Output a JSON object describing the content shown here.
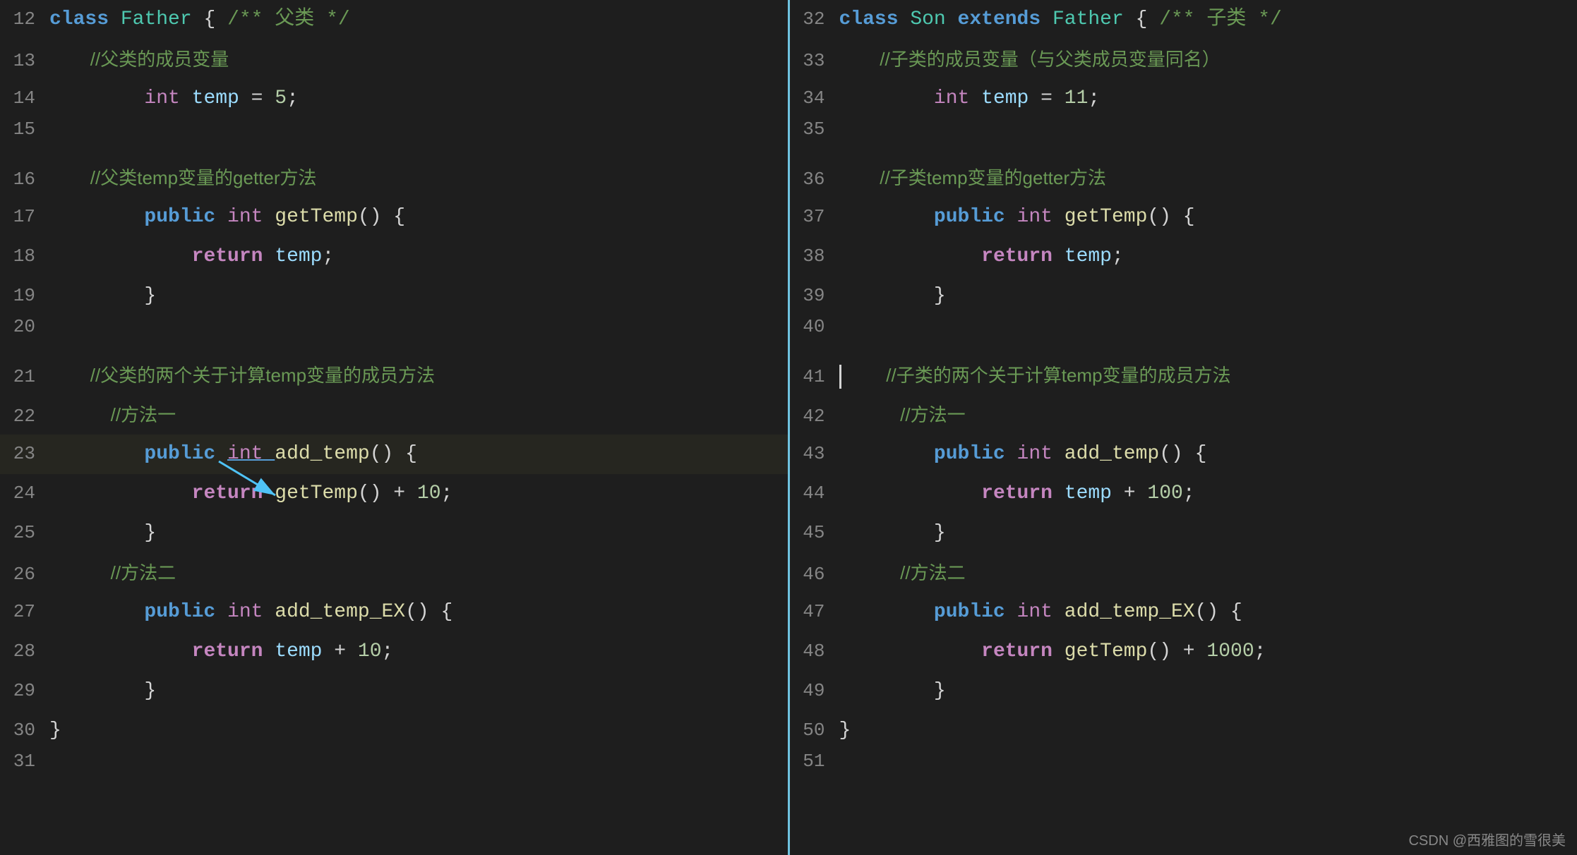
{
  "left": {
    "title": "Father",
    "lines": [
      {
        "num": 12,
        "tokens": [
          {
            "t": "kw-blue",
            "v": "class "
          },
          {
            "t": "classname",
            "v": "Father "
          },
          {
            "t": "plain",
            "v": "{ "
          },
          {
            "t": "comment",
            "v": "/** 父类 */"
          }
        ]
      },
      {
        "num": 13,
        "tokens": [
          {
            "t": "comment-cn",
            "v": "        //父类的成员变量"
          }
        ]
      },
      {
        "num": 14,
        "tokens": [
          {
            "t": "plain",
            "v": "        "
          },
          {
            "t": "type-int",
            "v": "int "
          },
          {
            "t": "var",
            "v": "temp "
          },
          {
            "t": "plain",
            "v": "= "
          },
          {
            "t": "num",
            "v": "5"
          },
          {
            "t": "plain",
            "v": ";"
          }
        ]
      },
      {
        "num": 15,
        "tokens": []
      },
      {
        "num": 16,
        "tokens": [
          {
            "t": "comment-cn",
            "v": "        //父类temp变量的getter方法"
          }
        ]
      },
      {
        "num": 17,
        "tokens": [
          {
            "t": "plain",
            "v": "        "
          },
          {
            "t": "kw-blue",
            "v": "public "
          },
          {
            "t": "type-int",
            "v": "int "
          },
          {
            "t": "fn",
            "v": "getTemp"
          },
          {
            "t": "plain",
            "v": "() {"
          }
        ]
      },
      {
        "num": 18,
        "tokens": [
          {
            "t": "plain",
            "v": "            "
          },
          {
            "t": "kw",
            "v": "return "
          },
          {
            "t": "var",
            "v": "temp"
          },
          {
            "t": "plain",
            "v": ";"
          }
        ]
      },
      {
        "num": 19,
        "tokens": [
          {
            "t": "plain",
            "v": "        }"
          }
        ]
      },
      {
        "num": 20,
        "tokens": []
      },
      {
        "num": 21,
        "tokens": [
          {
            "t": "comment-cn",
            "v": "        //父类的两个关于计算temp变量的成员方法"
          }
        ]
      },
      {
        "num": 22,
        "tokens": [
          {
            "t": "comment-cn",
            "v": "            //方法一"
          }
        ]
      },
      {
        "num": 23,
        "tokens": [
          {
            "t": "plain",
            "v": "        "
          },
          {
            "t": "kw-blue",
            "v": "public "
          },
          {
            "t": "type-int",
            "v": "int "
          },
          {
            "t": "fn",
            "v": "add_temp"
          },
          {
            "t": "plain",
            "v": "() {"
          }
        ],
        "highlight": true,
        "underline_int": true
      },
      {
        "num": 24,
        "tokens": [
          {
            "t": "plain",
            "v": "            "
          },
          {
            "t": "kw",
            "v": "return "
          },
          {
            "t": "fn",
            "v": "getTemp"
          },
          {
            "t": "plain",
            "v": "() + "
          },
          {
            "t": "num",
            "v": "10"
          },
          {
            "t": "plain",
            "v": ";"
          }
        ],
        "arrow": true
      },
      {
        "num": 25,
        "tokens": [
          {
            "t": "plain",
            "v": "        }"
          }
        ]
      },
      {
        "num": 26,
        "tokens": [
          {
            "t": "comment-cn",
            "v": "            //方法二"
          }
        ]
      },
      {
        "num": 27,
        "tokens": [
          {
            "t": "plain",
            "v": "        "
          },
          {
            "t": "kw-blue",
            "v": "public "
          },
          {
            "t": "type-int",
            "v": "int "
          },
          {
            "t": "fn",
            "v": "add_temp_EX"
          },
          {
            "t": "plain",
            "v": "() {"
          }
        ]
      },
      {
        "num": 28,
        "tokens": [
          {
            "t": "plain",
            "v": "            "
          },
          {
            "t": "kw",
            "v": "return "
          },
          {
            "t": "var",
            "v": "temp"
          },
          {
            "t": "plain",
            "v": " + "
          },
          {
            "t": "num",
            "v": "10"
          },
          {
            "t": "plain",
            "v": ";"
          }
        ]
      },
      {
        "num": 29,
        "tokens": [
          {
            "t": "plain",
            "v": "        }"
          }
        ]
      },
      {
        "num": 30,
        "tokens": [
          {
            "t": "plain",
            "v": "}"
          }
        ]
      },
      {
        "num": 31,
        "tokens": []
      }
    ]
  },
  "right": {
    "title": "Son extends Father",
    "lines": [
      {
        "num": 32,
        "tokens": [
          {
            "t": "kw-blue",
            "v": "class "
          },
          {
            "t": "classname",
            "v": "Son "
          },
          {
            "t": "kw-blue",
            "v": "extends "
          },
          {
            "t": "classname",
            "v": "Father "
          },
          {
            "t": "plain",
            "v": "{ "
          },
          {
            "t": "comment",
            "v": "/** 子类 */"
          }
        ]
      },
      {
        "num": 33,
        "tokens": [
          {
            "t": "comment-cn",
            "v": "        //子类的成员变量（与父类成员变量同名）"
          }
        ]
      },
      {
        "num": 34,
        "tokens": [
          {
            "t": "plain",
            "v": "        "
          },
          {
            "t": "type-int",
            "v": "int "
          },
          {
            "t": "var",
            "v": "temp "
          },
          {
            "t": "plain",
            "v": "= "
          },
          {
            "t": "num",
            "v": "11"
          },
          {
            "t": "plain",
            "v": ";"
          }
        ]
      },
      {
        "num": 35,
        "tokens": []
      },
      {
        "num": 36,
        "tokens": [
          {
            "t": "comment-cn",
            "v": "        //子类temp变量的getter方法"
          }
        ]
      },
      {
        "num": 37,
        "tokens": [
          {
            "t": "plain",
            "v": "        "
          },
          {
            "t": "kw-blue",
            "v": "public "
          },
          {
            "t": "type-int",
            "v": "int "
          },
          {
            "t": "fn",
            "v": "getTemp"
          },
          {
            "t": "plain",
            "v": "() {"
          }
        ]
      },
      {
        "num": 38,
        "tokens": [
          {
            "t": "plain",
            "v": "            "
          },
          {
            "t": "kw",
            "v": "return "
          },
          {
            "t": "var",
            "v": "temp"
          },
          {
            "t": "plain",
            "v": ";"
          }
        ]
      },
      {
        "num": 39,
        "tokens": [
          {
            "t": "plain",
            "v": "        }"
          }
        ]
      },
      {
        "num": 40,
        "tokens": []
      },
      {
        "num": 41,
        "tokens": [
          {
            "t": "comment-cn",
            "v": "        //子类的两个关于计算temp变量的成员方法"
          }
        ],
        "cursor": true
      },
      {
        "num": 42,
        "tokens": [
          {
            "t": "comment-cn",
            "v": "            //方法一"
          }
        ]
      },
      {
        "num": 43,
        "tokens": [
          {
            "t": "plain",
            "v": "        "
          },
          {
            "t": "kw-blue",
            "v": "public "
          },
          {
            "t": "type-int",
            "v": "int "
          },
          {
            "t": "fn",
            "v": "add_temp"
          },
          {
            "t": "plain",
            "v": "() {"
          }
        ]
      },
      {
        "num": 44,
        "tokens": [
          {
            "t": "plain",
            "v": "            "
          },
          {
            "t": "kw",
            "v": "return "
          },
          {
            "t": "var",
            "v": "temp"
          },
          {
            "t": "plain",
            "v": " + "
          },
          {
            "t": "num",
            "v": "100"
          },
          {
            "t": "plain",
            "v": ";"
          }
        ]
      },
      {
        "num": 45,
        "tokens": [
          {
            "t": "plain",
            "v": "        }"
          }
        ]
      },
      {
        "num": 46,
        "tokens": [
          {
            "t": "comment-cn",
            "v": "            //方法二"
          }
        ]
      },
      {
        "num": 47,
        "tokens": [
          {
            "t": "plain",
            "v": "        "
          },
          {
            "t": "kw-blue",
            "v": "public "
          },
          {
            "t": "type-int",
            "v": "int "
          },
          {
            "t": "fn",
            "v": "add_temp_EX"
          },
          {
            "t": "plain",
            "v": "() {"
          }
        ]
      },
      {
        "num": 48,
        "tokens": [
          {
            "t": "plain",
            "v": "            "
          },
          {
            "t": "kw",
            "v": "return "
          },
          {
            "t": "fn",
            "v": "getTemp"
          },
          {
            "t": "plain",
            "v": "() + "
          },
          {
            "t": "num",
            "v": "1000"
          },
          {
            "t": "plain",
            "v": ";"
          }
        ]
      },
      {
        "num": 49,
        "tokens": [
          {
            "t": "plain",
            "v": "        }"
          }
        ]
      },
      {
        "num": 50,
        "tokens": [
          {
            "t": "plain",
            "v": "}"
          }
        ]
      },
      {
        "num": 51,
        "tokens": []
      }
    ]
  },
  "watermark": "CSDN @西雅图的雪很美"
}
